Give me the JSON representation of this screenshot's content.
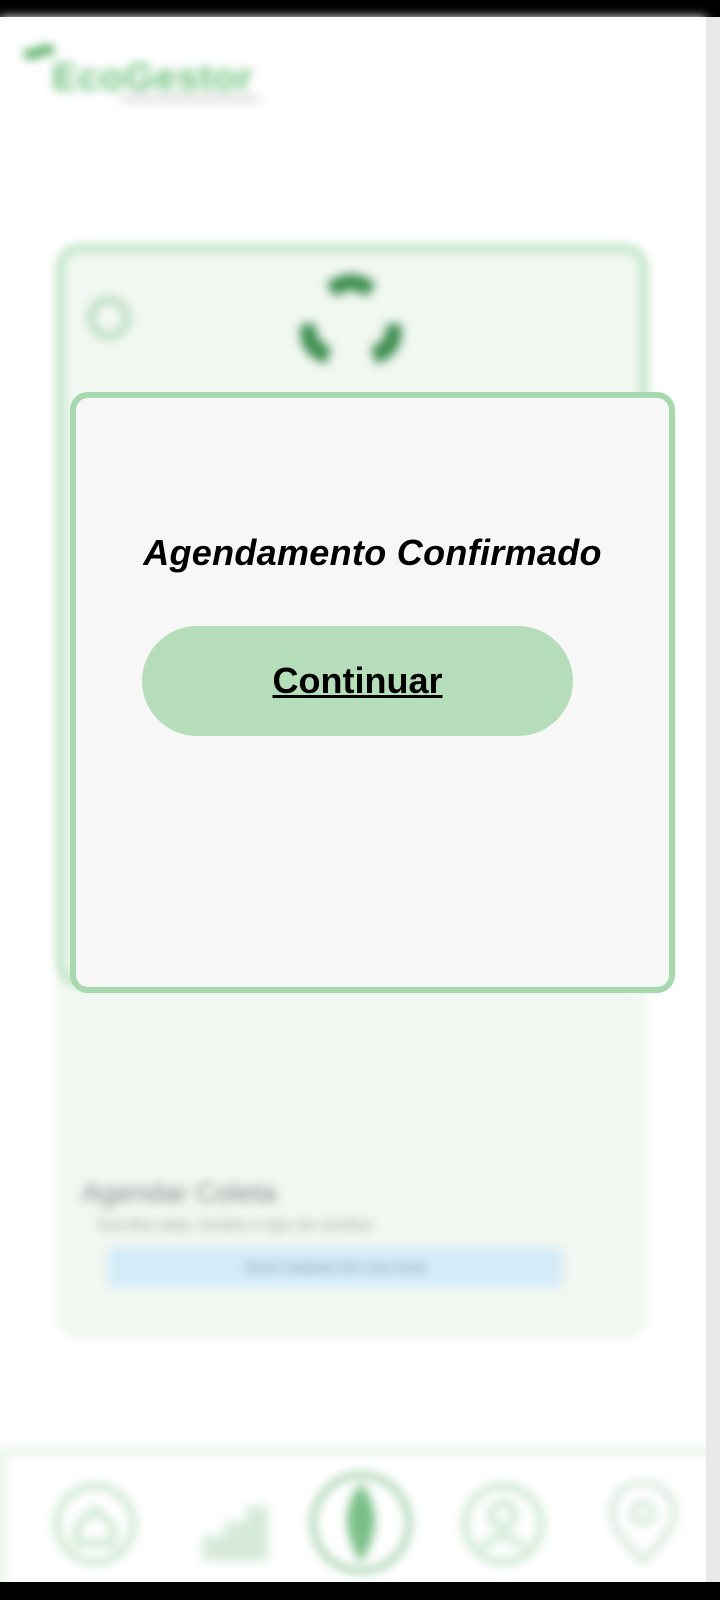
{
  "header": {
    "app_name": "EcoGestor"
  },
  "background_card": {
    "schedule_title": "Agendar Coleta",
    "schedule_subtitle": "Escolha data, horário e tipo de resíduo",
    "schedule_button": "Novo Cadastro Em Sua Área"
  },
  "dialog": {
    "title": "Agendamento Confirmado",
    "continue_label": "Continuar"
  },
  "bottom_nav": {
    "items": [
      "home-icon",
      "chart-icon",
      "leaf-icon",
      "user-icon",
      "location-icon"
    ]
  },
  "colors": {
    "accent_green": "#a7d8ae",
    "button_green": "#b6ddb9",
    "dialog_bg": "#f7f7f7"
  }
}
